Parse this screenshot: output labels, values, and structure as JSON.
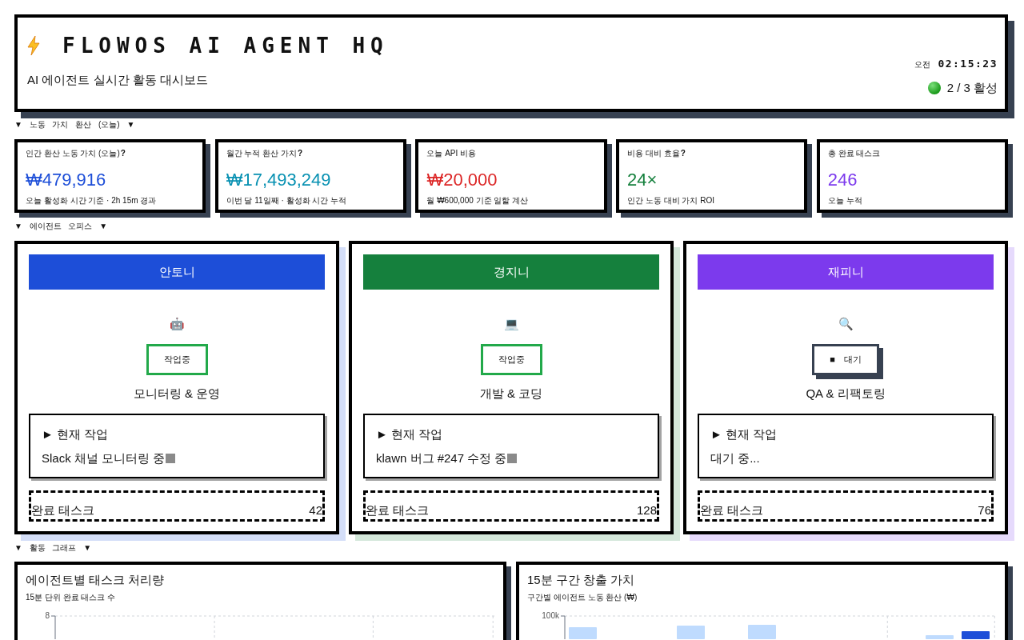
{
  "header": {
    "title": "FLOWOS AI AGENT HQ",
    "subtitle": "AI 에이전트 실시간 활동 대시보드",
    "clock_period": "오전",
    "clock_time": "02:15:23",
    "active_summary": "2 / 3 활성"
  },
  "labor_value": {
    "heading": "▼ 노동 가치 환산 (오늘) ▼",
    "metrics": [
      {
        "label": "인간 환산 노동 가치 (오늘)",
        "help": "?",
        "value": "₩479,916",
        "note": "오늘 활성화 시간 기준 · 2h 15m 경과",
        "color": "#1d4ed8"
      },
      {
        "label": "월간 누적 환산 가치",
        "help": "?",
        "value": "₩17,493,249",
        "note": "이번 달 11일째 · 활성화 시간 누적",
        "color": "#0891b2"
      },
      {
        "label": "오늘 API 비용",
        "value": "₩20,000",
        "note": "월 ₩600,000 기준 일할 계산",
        "color": "#dc2626"
      },
      {
        "label": "비용 대비 효율",
        "help": "?",
        "value": "24×",
        "note": "인간 노동 대비 가치 ROI",
        "color": "#15803d"
      },
      {
        "label": "총 완료 태스크",
        "value": "246",
        "note": "오늘 누적",
        "color": "#7c3aed"
      }
    ]
  },
  "agent_office": {
    "heading": "▼ 에이전트 오피스 ▼",
    "agents": [
      {
        "name": "안토니",
        "color": "#1d4ed8",
        "avatar": "🤖",
        "status": {
          "kind": "working",
          "label": "작업중"
        },
        "role": "모니터링 & 운영",
        "task": {
          "heading": "► 현재 작업",
          "text": "Slack 채널 모니터링 중",
          "typing": true
        },
        "completed": {
          "label": "완료 태스크",
          "count": "42"
        }
      },
      {
        "name": "경지니",
        "color": "#15803d",
        "avatar": "💻",
        "status": {
          "kind": "working",
          "label": "작업중"
        },
        "role": "개발 & 코딩",
        "task": {
          "heading": "► 현재 작업",
          "text": "klawn 버그 #247 수정 중",
          "typing": true
        },
        "completed": {
          "label": "완료 태스크",
          "count": "128"
        }
      },
      {
        "name": "재피니",
        "color": "#7c3aed",
        "avatar": "🔍",
        "status": {
          "kind": "idle",
          "label": "■ 대기"
        },
        "role": "QA & 리팩토링",
        "task": {
          "heading": "► 현재 작업",
          "text": "대기 중...",
          "typing": false
        },
        "completed": {
          "label": "완료 태스크",
          "count": "76"
        }
      }
    ]
  },
  "activity_graphs": {
    "heading": "▼ 활동 그래프 ▼",
    "charts": [
      {
        "kind": "grid",
        "title": "에이전트별 태스크 처리량",
        "subtitle": "15분 단위 완료 태스크 수",
        "y_tick": "8"
      },
      {
        "kind": "bars",
        "title": "15분 구간 창출 가치",
        "subtitle": "구간별 에이전트 노동 환산 (₩)",
        "y_tick": "100k"
      }
    ]
  }
}
